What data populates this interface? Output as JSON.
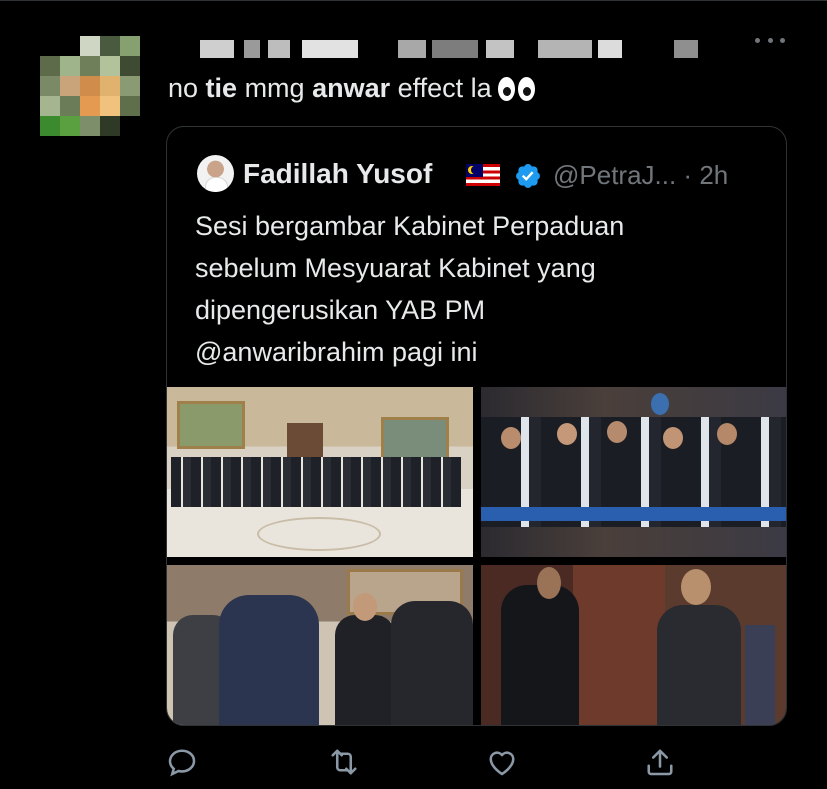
{
  "tweet": {
    "text_part1": "no ",
    "text_bold1": "tie",
    "text_part2": " mmg ",
    "text_bold2": "anwar",
    "text_part3": " effect la",
    "emoji": "eyes-emoji"
  },
  "quoted": {
    "display_name": "Fadillah Yusof",
    "handle_time": "@PetraJ... · 2h",
    "text": "Sesi bergambar Kabinet Perpaduan\nsebelum Mesyuarat Kabinet yang\ndipengerusikan YAB PM\n@anwaribrahim pagi ini",
    "flag": "malaysia-flag-icon",
    "verified": "verified-badge-icon"
  },
  "actions": [
    "reply-icon",
    "retweet-icon",
    "like-icon",
    "share-icon"
  ],
  "colors": {
    "background": "#000000",
    "text": "#e7e9ea",
    "muted": "#71767b",
    "border": "#2f3336",
    "verified": "#1d9bf0"
  }
}
